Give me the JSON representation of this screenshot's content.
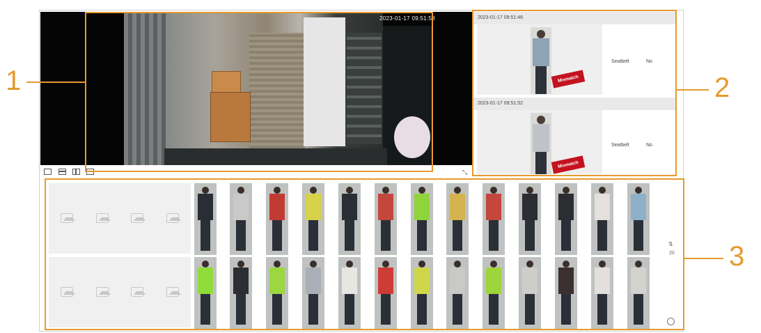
{
  "video": {
    "osd_timestamp": "2023-01-17 09:51:58"
  },
  "layout_icons": [
    "layout-single-icon",
    "layout-split-horizontal-icon",
    "layout-split-vertical-icon",
    "layout-fullscreen-icon"
  ],
  "records": [
    {
      "timestamp": "2023-01-17 09:51:46",
      "badge": "Mismatch",
      "attr_label": "Seatbelt",
      "attr_value": "No"
    },
    {
      "timestamp": "2023-01-17 09:51:52",
      "badge": "Mismatch",
      "attr_label": "Seatbelt",
      "attr_value": "No"
    }
  ],
  "gallery": {
    "empty_slots_per_row": 4,
    "rows": 2,
    "people_per_row": 13,
    "top_row_tops": [
      "#2a2d33",
      "#c9c9c7",
      "#c23b33",
      "#d8d24a",
      "#2b2f35",
      "#c4473d",
      "#8fd43a",
      "#d4b24e",
      "#c4463c",
      "#2c2e33",
      "#2b2d31",
      "#e3e0dd",
      "#8fb0c9"
    ],
    "bottom_row_tops": [
      "#8fdc3a",
      "#2c2e33",
      "#9bd73f",
      "#a9afb6",
      "#e8e6e3",
      "#cf3c35",
      "#cfd64a",
      "#c9c9c5",
      "#9ed43c",
      "#cfcdc9",
      "#3a3030",
      "#e2dfdc",
      "#d3d2cf"
    ],
    "side_control_label": "⇅",
    "side_control_value": "20"
  },
  "annotations": {
    "label_1": "1",
    "label_2": "2",
    "label_3": "3",
    "color": "#e69a2e"
  }
}
